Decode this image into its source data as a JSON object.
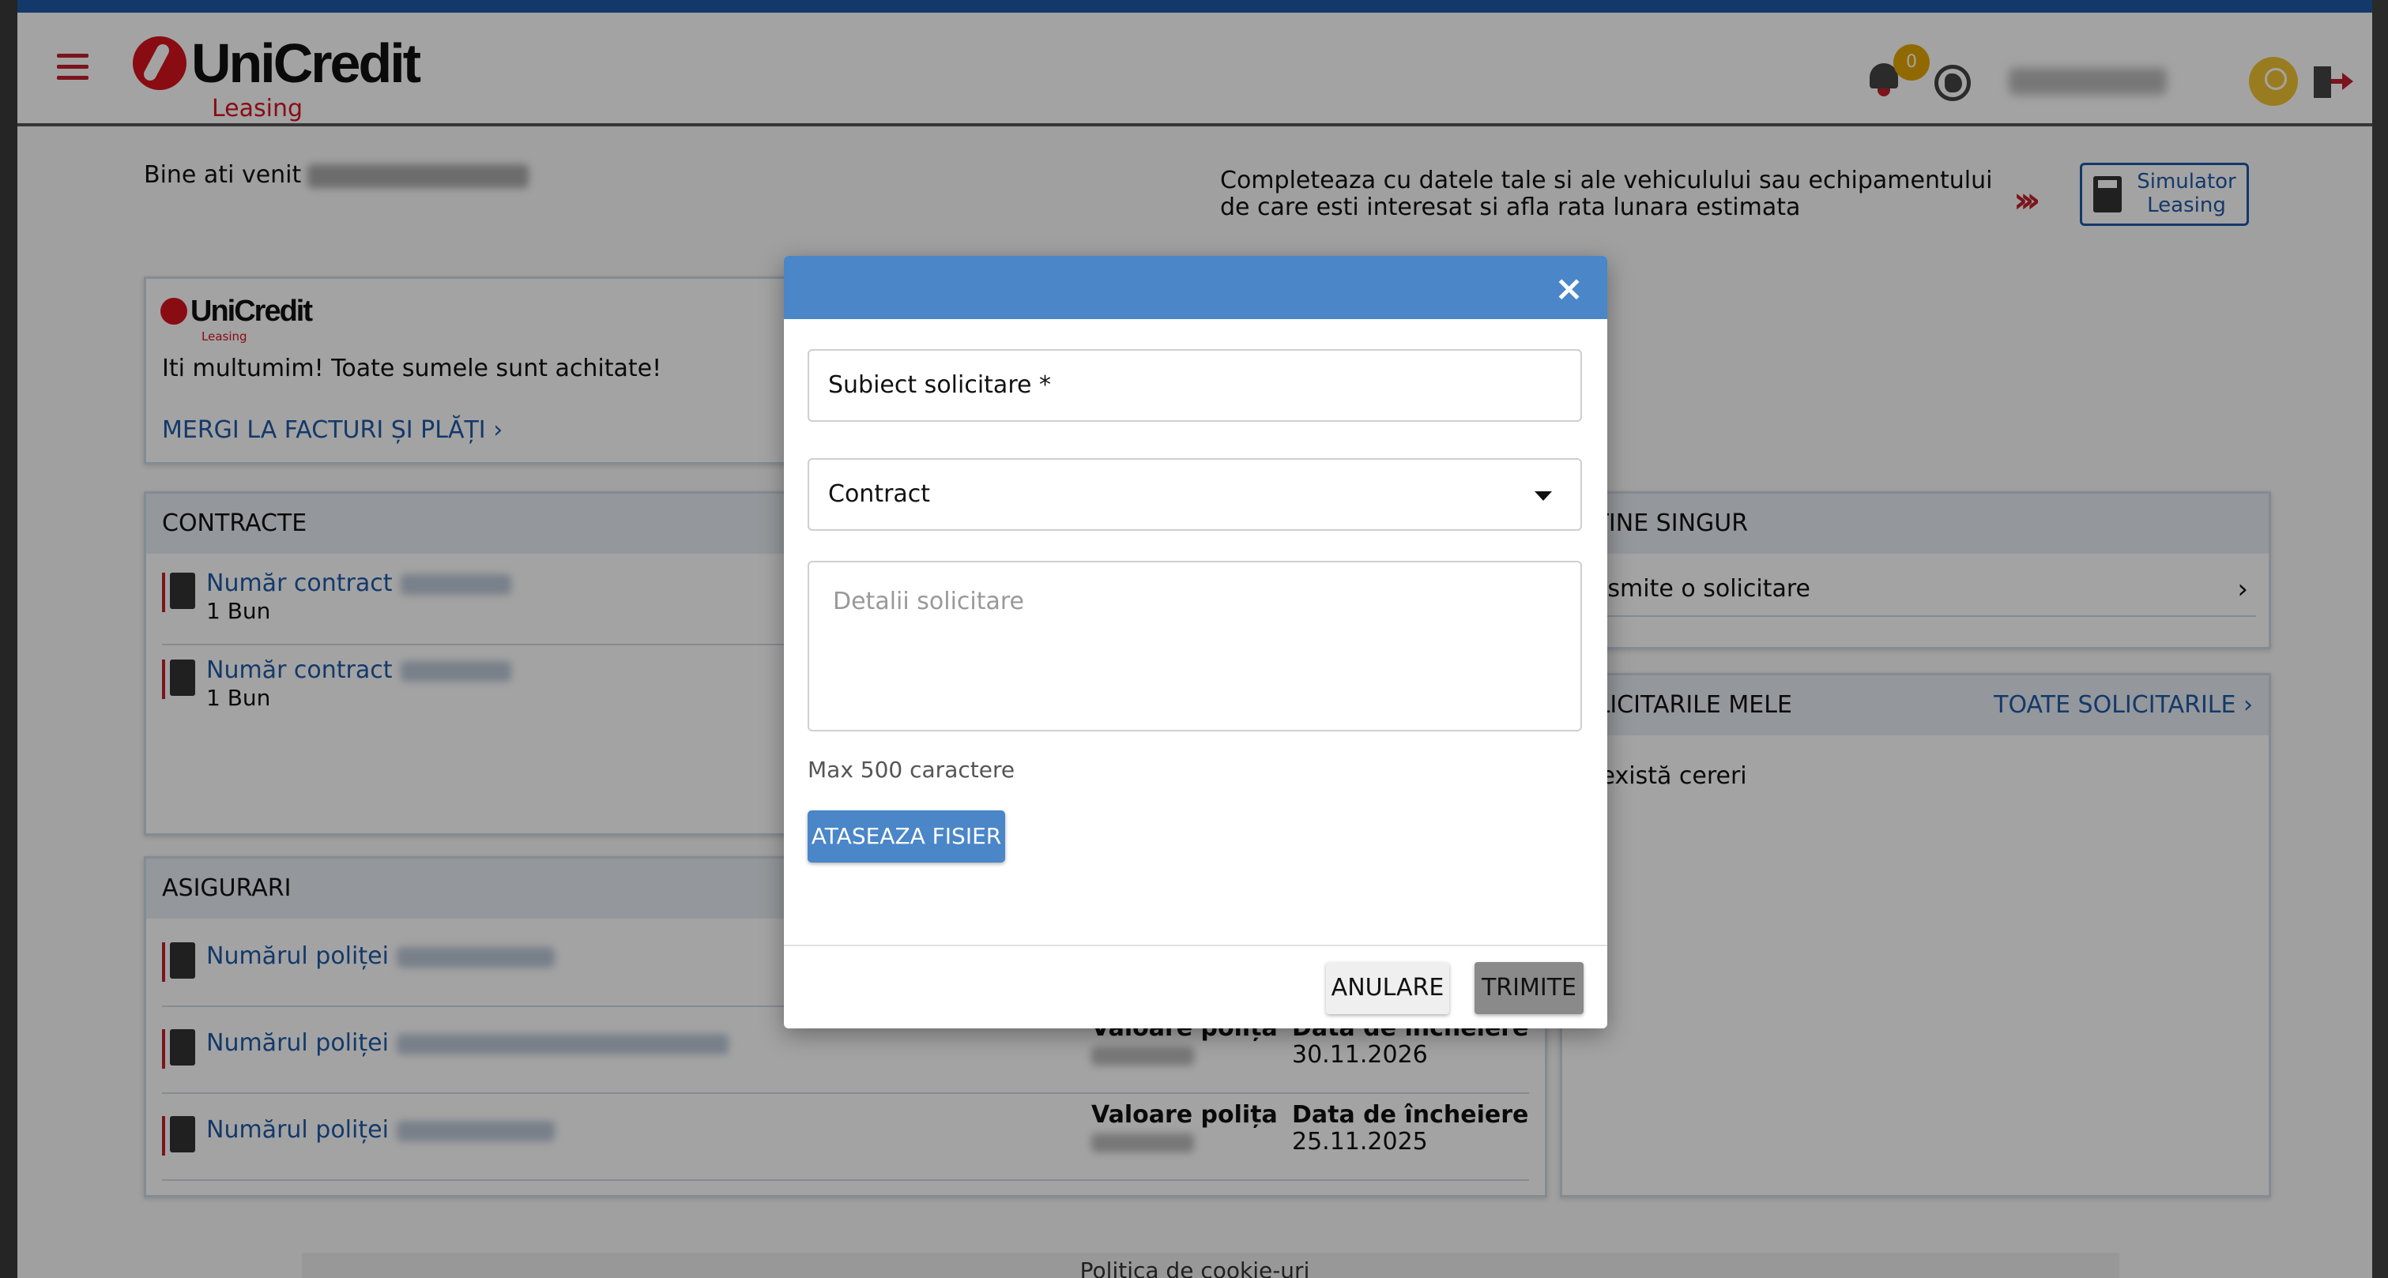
{
  "header": {
    "logo_text": "UniCredit",
    "logo_sub": "Leasing",
    "notification_count": "0"
  },
  "welcome": {
    "prefix": "Bine ati venit"
  },
  "promo": {
    "text": "Completeaza cu datele tale si ale vehiculului sau echipamentului de care esti interesat si afla rata lunara estimata",
    "chevrons": "›››",
    "simulator_label": "Simulator Leasing"
  },
  "payments_card": {
    "logo_text": "UniCredit",
    "logo_sub": "Leasing",
    "message": "Iti multumim! Toate sumele sunt achitate!",
    "link": "MERGI LA FACTURI ȘI PLĂȚI  ›"
  },
  "contracts": {
    "title": "CONTRACTE",
    "items": [
      {
        "label": "Număr contract",
        "sub": "1 Bun"
      },
      {
        "label": "Număr contract",
        "sub": "1 Bun"
      }
    ]
  },
  "insurance": {
    "title": "ASIGURARI",
    "items": [
      {
        "label": "Numărul poliței",
        "value_label": "",
        "end_label": "",
        "end_date": ""
      },
      {
        "label": "Numărul poliței",
        "value_label": "Valoare polița",
        "end_label": "Data de încheiere",
        "end_date": "30.11.2026"
      },
      {
        "label": "Numărul poliței",
        "value_label": "Valoare polița",
        "end_label": "Data de încheiere",
        "end_date": "25.11.2025"
      }
    ]
  },
  "self_service": {
    "title": "BTINE SINGUR",
    "item": "ansmite o solicitare",
    "chevron": "›"
  },
  "my_requests": {
    "title": "OLICITARILE MELE",
    "all_link": "TOATE SOLICITARILE  ›",
    "empty": "u există cereri"
  },
  "footer": {
    "cookie": "Politica de cookie-uri"
  },
  "modal": {
    "close": "×",
    "subject_label": "Subiect solicitare *",
    "contract_label": "Contract",
    "details_placeholder": "Detalii solicitare",
    "hint": "Max 500 caractere",
    "attach_label": "ATASEAZA FISIER",
    "cancel_label": "ANULARE",
    "send_label": "TRIMITE"
  }
}
